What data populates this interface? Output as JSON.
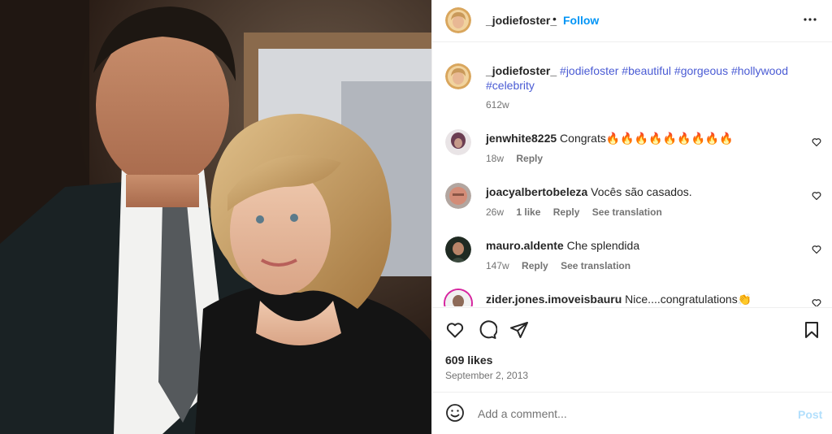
{
  "post": {
    "username": "_jodiefoster_",
    "separator": "•",
    "follow_label": "Follow"
  },
  "caption": {
    "username": "_jodiefoster_",
    "hashtags": "#jodiefoster #beautiful #gorgeous #hollywood #celebrity",
    "age": "612w"
  },
  "comments": [
    {
      "username": "jenwhite8225",
      "text": "Congrats🔥🔥🔥🔥🔥🔥🔥🔥🔥",
      "age": "18w",
      "likes": "",
      "reply": "Reply",
      "translate": ""
    },
    {
      "username": "joacyalbertobeleza",
      "text": "Vocês são casados.",
      "age": "26w",
      "likes": "1 like",
      "reply": "Reply",
      "translate": "See translation"
    },
    {
      "username": "mauro.aldente",
      "text": "Che splendida",
      "age": "147w",
      "likes": "",
      "reply": "Reply",
      "translate": "See translation"
    },
    {
      "username": "zider.jones.imoveisbauru",
      "text": "Nice....congratulations👏",
      "age": "",
      "likes": "",
      "reply": "",
      "translate": ""
    }
  ],
  "actions": {
    "likes": "609 likes",
    "date": "September 2, 2013"
  },
  "add_comment": {
    "placeholder": "Add a comment...",
    "post_label": "Post"
  },
  "colors": {
    "accent": "#0095f6",
    "hashtag": "#4a5bd4",
    "muted": "#737373",
    "post_disabled": "#b2dffc"
  }
}
